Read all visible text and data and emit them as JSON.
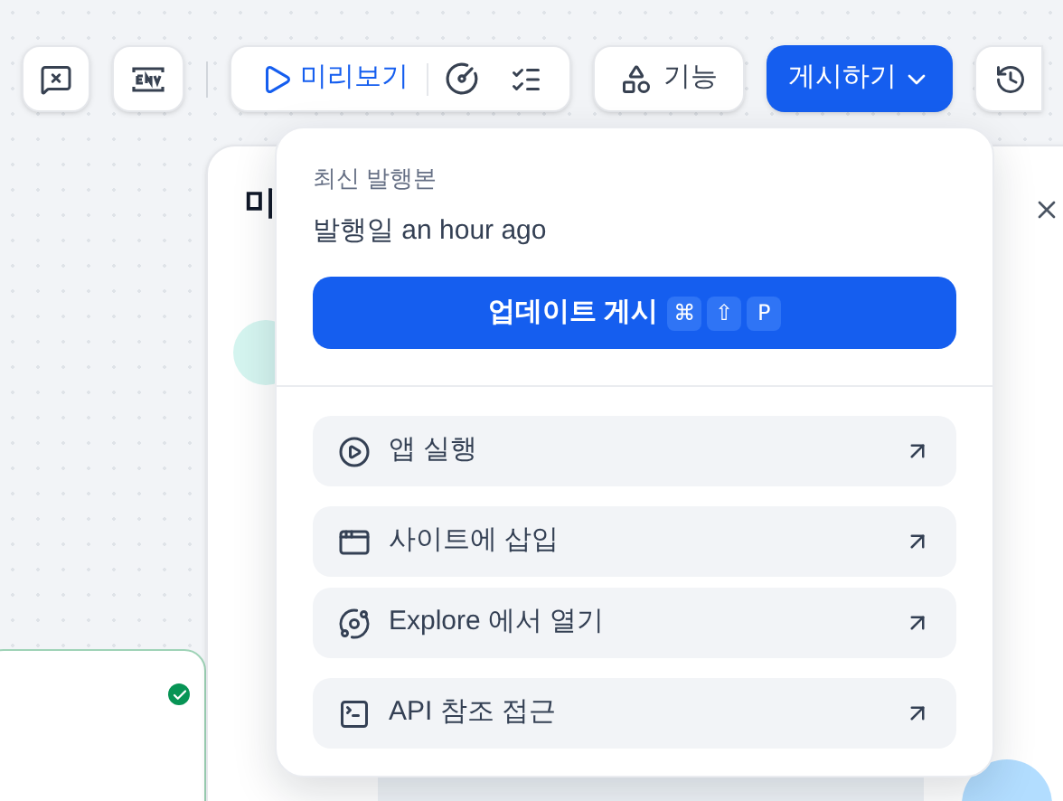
{
  "toolbar": {
    "preview": "미리보기",
    "features": "기능",
    "publish": "게시하기"
  },
  "panel": {
    "title": "미"
  },
  "publish_menu": {
    "heading": "최신 발행본",
    "published": "발행일 an hour ago",
    "update_button": "업데이트 게시",
    "shortcut": [
      "⌘",
      "⇧",
      "P"
    ],
    "items": [
      {
        "label": "앱 실행"
      },
      {
        "label": "사이트에 삽입"
      },
      {
        "label": "Explore 에서 열기"
      },
      {
        "label": "API 참조 접근"
      }
    ]
  }
}
